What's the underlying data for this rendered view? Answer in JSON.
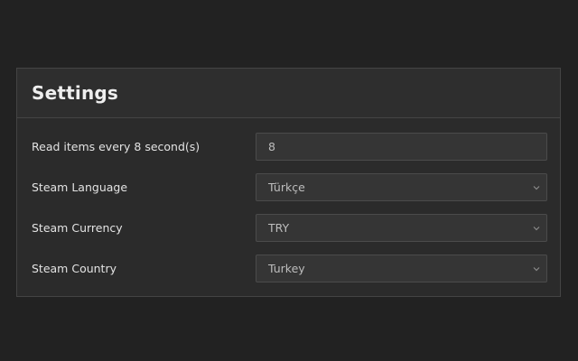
{
  "panel": {
    "title": "Settings"
  },
  "settings": [
    {
      "label": "Read items every 8 second(s)",
      "value": "8",
      "type": "input"
    },
    {
      "label": "Steam Language",
      "value": "Türkçe",
      "type": "select"
    },
    {
      "label": "Steam Currency",
      "value": "TRY",
      "type": "select"
    },
    {
      "label": "Steam Country",
      "value": "Turkey",
      "type": "select"
    }
  ],
  "icons": {
    "select": "chevron-down-icon"
  },
  "colors": {
    "background": "#222222",
    "panel": "#2b2b2b",
    "control": "#353535",
    "border": "#444444"
  }
}
